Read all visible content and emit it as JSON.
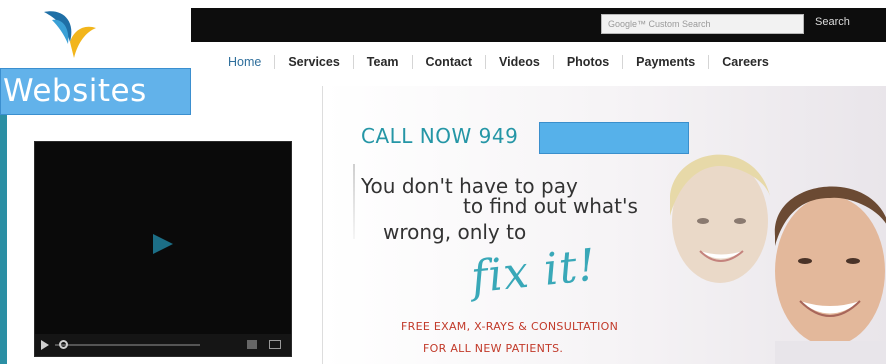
{
  "header": {
    "badge_label": "Websites",
    "search": {
      "placeholder": "Google™ Custom Search",
      "button_label": "Search"
    }
  },
  "nav": {
    "items": [
      {
        "label": "Home"
      },
      {
        "label": "Services"
      },
      {
        "label": "Team"
      },
      {
        "label": "Contact"
      },
      {
        "label": "Videos"
      },
      {
        "label": "Photos"
      },
      {
        "label": "Payments"
      },
      {
        "label": "Careers"
      }
    ]
  },
  "banner": {
    "call_label": "CALL NOW 949",
    "tagline_1": "You don't have to pay",
    "tagline_2": "to find out what's",
    "tagline_3": "wrong, only to",
    "emphasis": "fix it!",
    "offer_line_1": "FREE EXAM, X-RAYS & CONSULTATION",
    "offer_line_2": "FOR ALL NEW PATIENTS."
  },
  "colors": {
    "badge": "#62b2ea",
    "redaction": "#56b1ea",
    "accent_teal": "#2596a6",
    "offer_red": "#c23a2a",
    "topbar": "#0d0d0d"
  },
  "icons": [
    "logo-swoosh-icon",
    "play-icon",
    "volume-icon",
    "fullscreen-icon"
  ]
}
